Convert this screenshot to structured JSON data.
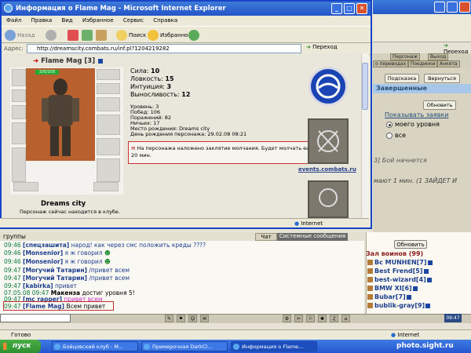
{
  "popup": {
    "title": "Информация о Flame Mag - Microsoft Internet Explorer",
    "menu": [
      "Файл",
      "Правка",
      "Вид",
      "Избранное",
      "Сервис",
      "Справка"
    ],
    "toolbar": {
      "back": "Назад",
      "search": "Поиск",
      "favorites": "Избранное"
    },
    "address_label": "Адрес:",
    "address": "http://dreamscity.combats.ru/inf.pl?1204219282",
    "go_label": "Переход",
    "status_zone": "Internet"
  },
  "character": {
    "name": "Flame Mag",
    "level": "[3]",
    "hp": "105/105",
    "city": "Dreams city",
    "club_note": "Персонаж сейчас находится в клубе.",
    "stats": [
      {
        "label": "Сила:",
        "value": "10"
      },
      {
        "label": "Ловкость:",
        "value": "15"
      },
      {
        "label": "Интуиция:",
        "value": "3"
      },
      {
        "label": "Выносливость:",
        "value": "12"
      }
    ],
    "info": [
      "Уровень: 3",
      "Побед: 106",
      "Поражений: 82",
      "Ничьих: 17",
      "Место рождения: Dreams city",
      "День рождения персонажа: 29.02.08 08:21"
    ],
    "silence_note": "На персонажа наложено заклятие молчания. Будет молчать еще 20 мин.",
    "events_link": "events.combats.ru"
  },
  "bg_window": {
    "go_label": "Переход",
    "tabs": [
      "Персонаж",
      "Выход",
      "о переводах",
      "Поединки",
      "Анкета"
    ],
    "hint_button": "Подсказка",
    "return_button": "Вернуться",
    "completed": "Завершенные",
    "refresh_button": "Обновить",
    "show_requests": "Показывать заявки",
    "options": [
      "моего уровня",
      "все"
    ],
    "fight_text": "3] Бой начнется",
    "wait_text": "мают 1 мин. (1 ЗАЙДЕТ И"
  },
  "chat": {
    "header": "группы",
    "tabs": [
      "Чат",
      "Системные сообщения"
    ],
    "lines": [
      {
        "time": "09:46",
        "name": "[спецзашита]",
        "text": "народ! как через смс положить креды ????"
      },
      {
        "time": "09:46",
        "name": "[Monsenior]",
        "text": "я ж говорил"
      },
      {
        "time": "09:46",
        "name": "[Monsenior]",
        "text": "я ж говорил"
      },
      {
        "time": "09:47",
        "name": "[Могучий Татарин]",
        "text": "/привет всем"
      },
      {
        "time": "09:47",
        "name": "[Могучий Татарин]",
        "text": "/привет всем"
      },
      {
        "time": "09:47",
        "name": "[kabirka]",
        "text": "привет"
      },
      {
        "time": "07.05.08 09:47",
        "name": "Макенза",
        "text": "достиг уровня 5!"
      },
      {
        "time": "09:47",
        "name": "[mc rapper]",
        "text": "привет всем"
      },
      {
        "time": "09:47",
        "name": "[Flame Mag]",
        "text": "Всем привет"
      }
    ]
  },
  "users": {
    "refresh": "Обновить",
    "hall": "Зал воинов (99)",
    "list": [
      "Bc MUNHEN[7]",
      "Best Frend[5]",
      "best-wizard[4]",
      "BMW XI[6]",
      "Bubar[7]",
      "bublik-gray[9]"
    ]
  },
  "game_clock": "09:47",
  "main_status": {
    "ready": "Готово",
    "zone": "Internet"
  },
  "taskbar": {
    "start": "пуск",
    "tasks": [
      "Бойцовский клуб - M...",
      "Примерочная DarkCl...",
      "Информация о Flame..."
    ]
  },
  "watermark": "photo.sight.ru"
}
